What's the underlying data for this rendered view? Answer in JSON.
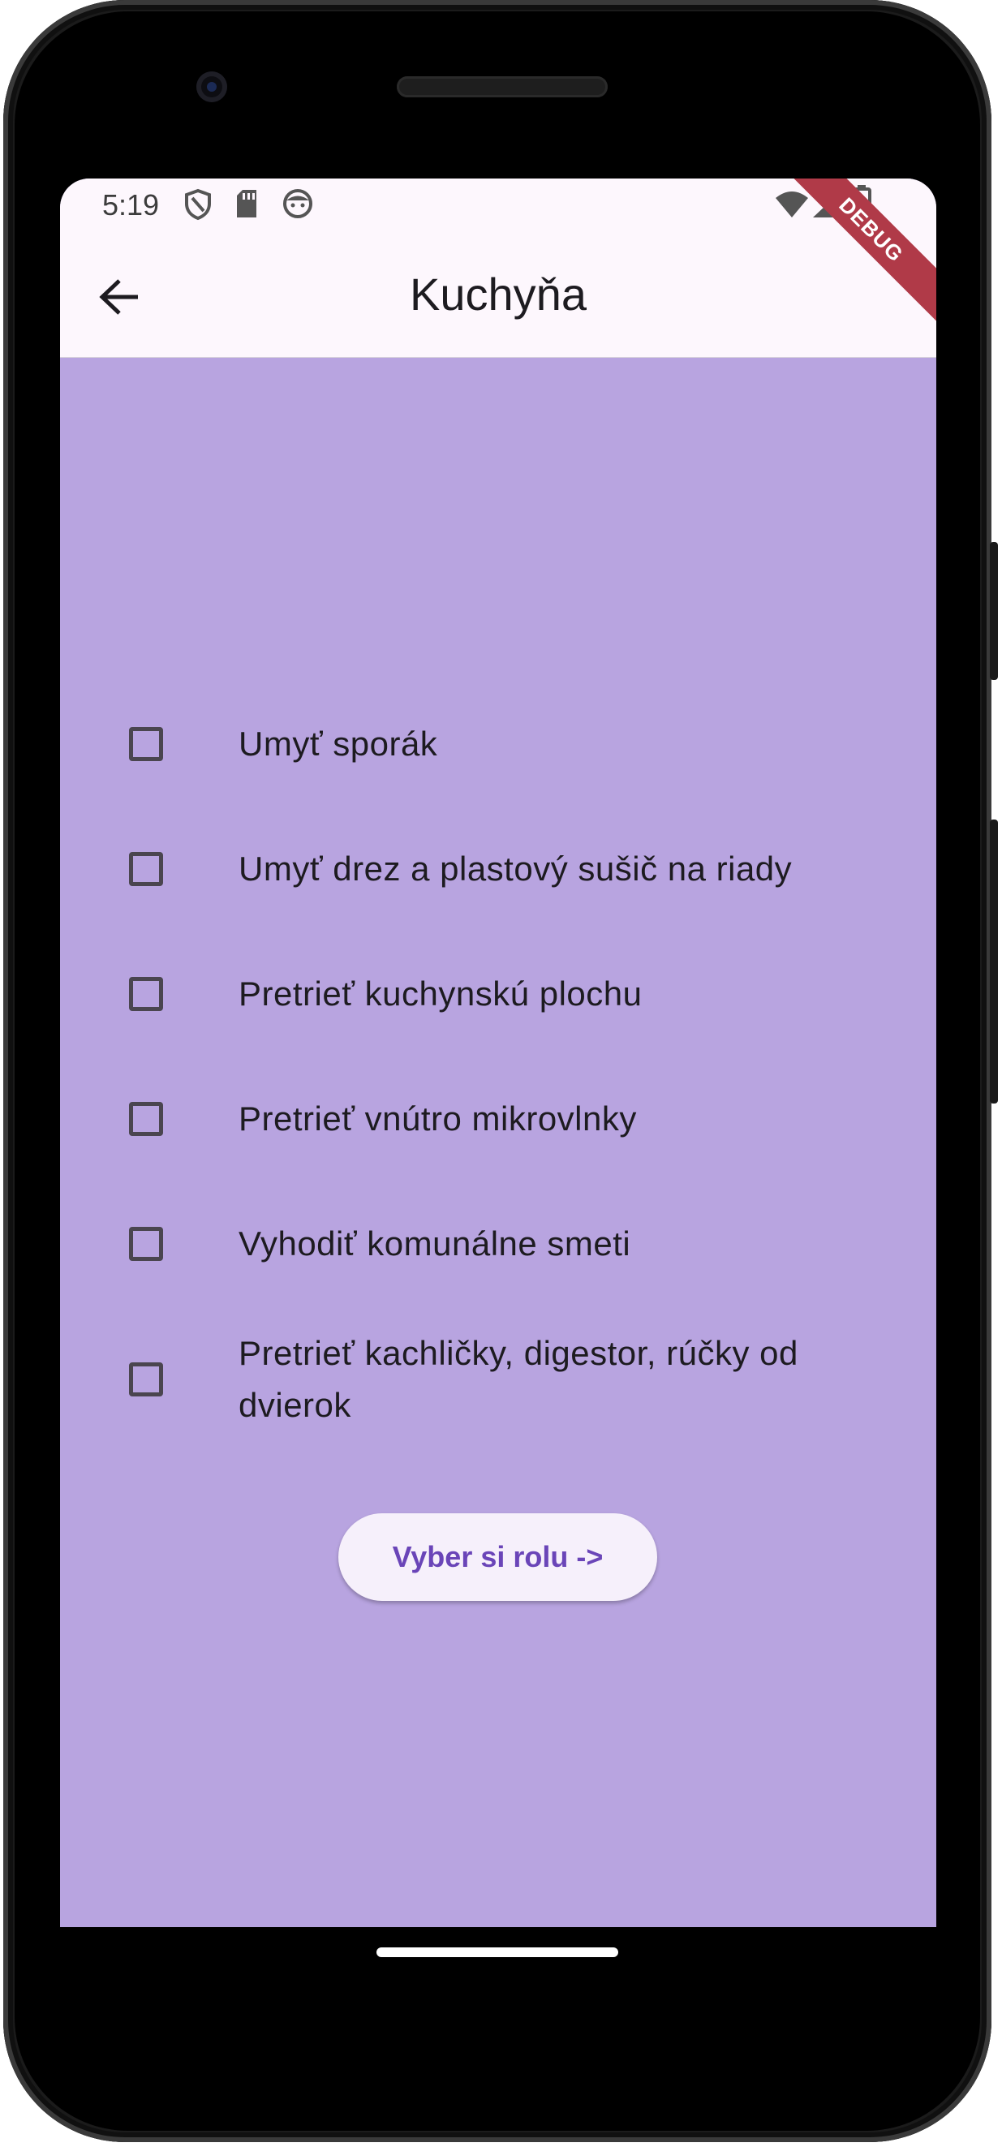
{
  "status_bar": {
    "time": "5:19",
    "icons_left": [
      "shield-icon",
      "sd-card-icon",
      "face-icon"
    ],
    "icons_right": [
      "wifi-icon",
      "signal-icon",
      "battery-icon"
    ]
  },
  "debug_banner": "DEBUG",
  "app_bar": {
    "title": "Kuchyňa",
    "back_icon": "arrow-back-icon"
  },
  "tasks": [
    {
      "label": "Umyť sporák",
      "checked": false
    },
    {
      "label": "Umyť drez a plastový sušič na riady",
      "checked": false
    },
    {
      "label": "Pretrieť kuchynskú plochu",
      "checked": false
    },
    {
      "label": "Pretrieť vnútro mikrovlnky",
      "checked": false
    },
    {
      "label": "Vyhodiť komunálne smeti",
      "checked": false
    },
    {
      "label": "Pretrieť kachličky, digestor, rúčky od dvierok",
      "checked": false
    }
  ],
  "primary_button": {
    "label": "Vyber si rolu ->"
  },
  "colors": {
    "screen_background": "#b8a4e0",
    "app_bar_background": "#fdf7fd",
    "button_text": "#6a45b8",
    "debug_banner": "#b03a48"
  }
}
